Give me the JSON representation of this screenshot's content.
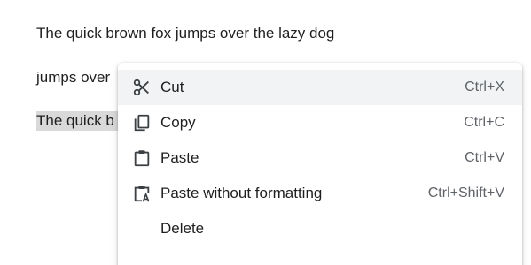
{
  "document": {
    "lines": [
      "The quick brown fox jumps over the lazy dog",
      "jumps over",
      "The quick b"
    ]
  },
  "context_menu": {
    "items": [
      {
        "label": "Cut",
        "shortcut": "Ctrl+X",
        "icon": "scissors-icon",
        "hovered": true
      },
      {
        "label": "Copy",
        "shortcut": "Ctrl+C",
        "icon": "copy-icon"
      },
      {
        "label": "Paste",
        "shortcut": "Ctrl+V",
        "icon": "clipboard-icon"
      },
      {
        "label": "Paste without formatting",
        "shortcut": "Ctrl+Shift+V",
        "icon": "paste-plain-icon"
      },
      {
        "label": "Delete",
        "shortcut": "",
        "icon": ""
      }
    ]
  },
  "colors": {
    "selection_highlight": "#d9d9d9",
    "hover_background": "#f1f3f4",
    "shortcut_text": "#5f6368"
  }
}
